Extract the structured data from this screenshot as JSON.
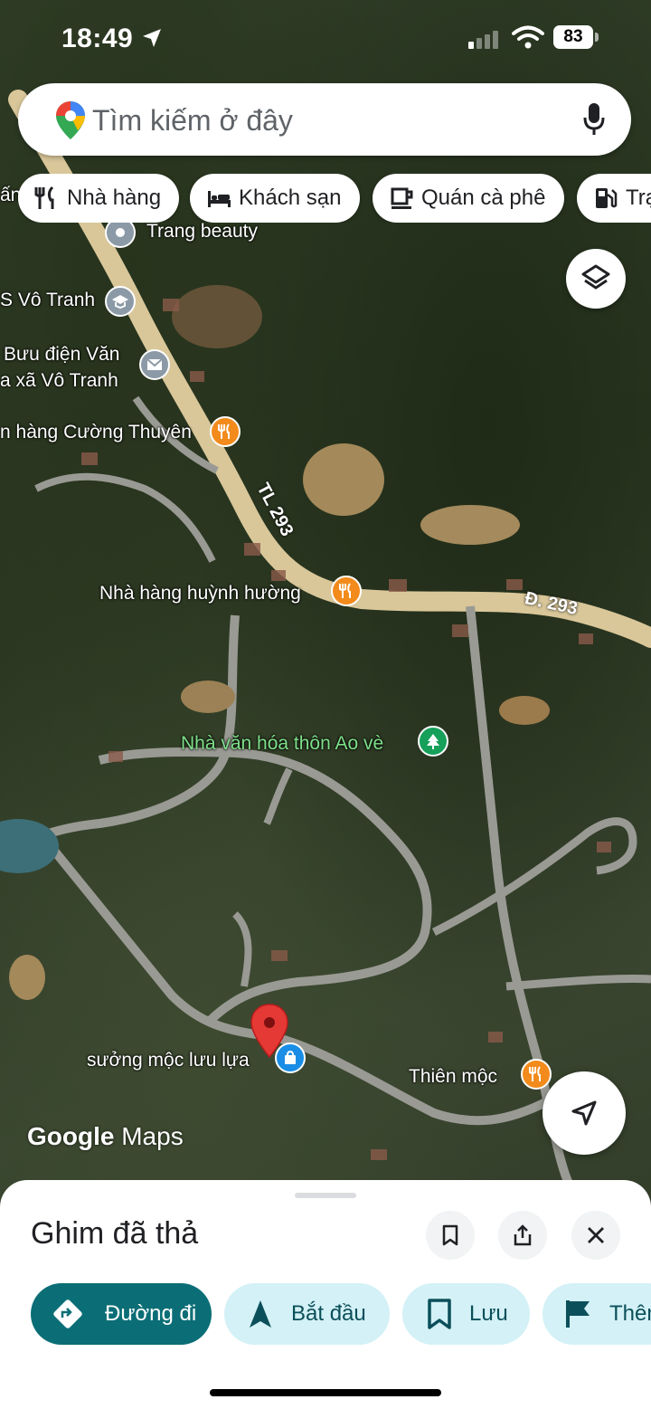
{
  "status_bar": {
    "time": "18:49",
    "battery": "83"
  },
  "search": {
    "placeholder": "Tìm kiếm ở đây"
  },
  "chips": [
    {
      "label": "Nhà hàng",
      "icon": "fork-knife-icon"
    },
    {
      "label": "Khách sạn",
      "icon": "bed-icon"
    },
    {
      "label": "Quán cà phê",
      "icon": "coffee-icon"
    },
    {
      "label": "Trạ",
      "icon": "gas-station-icon"
    }
  ],
  "map": {
    "pois": {
      "trang_beauty": "Trang beauty",
      "school": "S Vô Tranh",
      "post_office_line1": "Bưu điện Văn",
      "post_office_line2": "a xã Vô Tranh",
      "restaurant_cuong": "n hàng Cường Thuyên",
      "restaurant_huong": "Nhà hàng huỳnh hường",
      "culture_house": "Nhà văn hóa thôn Ao vè",
      "suong_moc": "sưởng mộc lưu lựa",
      "thien_moc": "Thiên mộc"
    },
    "road_labels": {
      "tl293": "TL 293",
      "d293": "Đ. 293"
    },
    "partial_left_top": "ấn",
    "logo": {
      "google": "Google",
      "maps": "Maps"
    }
  },
  "sheet": {
    "title": "Ghim đã thả",
    "actions": [
      {
        "label": "Đường đi",
        "icon": "directions-icon"
      },
      {
        "label": "Bắt đầu",
        "icon": "navigation-arrow-icon"
      },
      {
        "label": "Lưu",
        "icon": "bookmark-icon"
      },
      {
        "label": "Thêm",
        "icon": "flag-icon"
      }
    ]
  },
  "colors": {
    "primary": "#0b6e76",
    "secondary_bg": "#d3f1f6",
    "pin_red": "#e53935",
    "poi_orange": "#f28b1c"
  }
}
